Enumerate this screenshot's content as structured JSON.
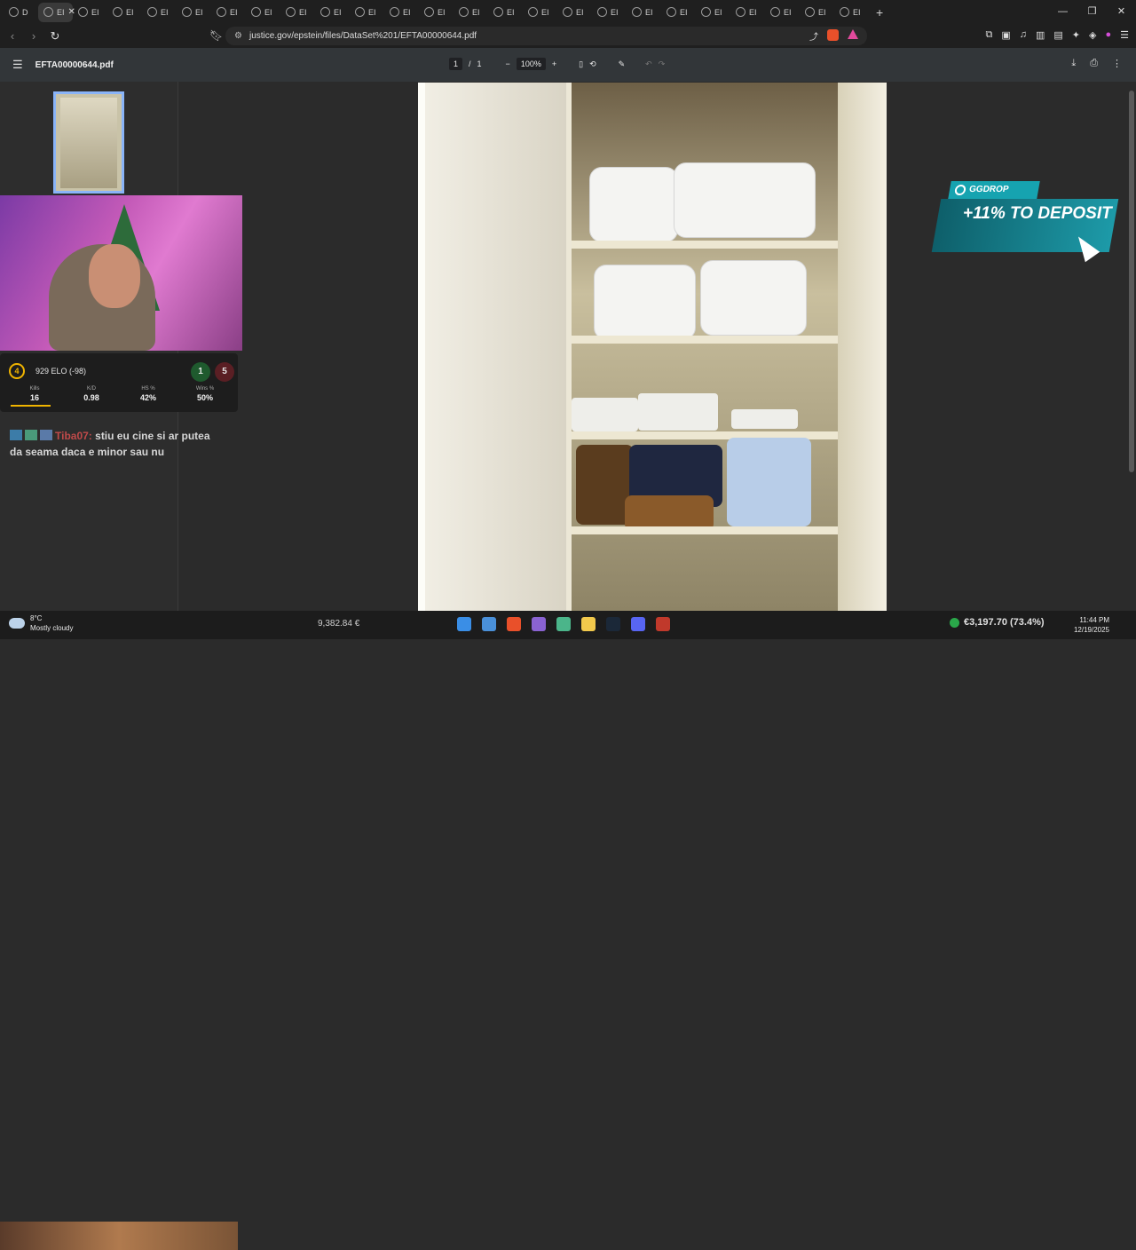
{
  "browser": {
    "tabs": [
      {
        "label": "D",
        "active": false
      },
      {
        "label": "EI",
        "active": true
      },
      {
        "label": "EI"
      },
      {
        "label": "EI"
      },
      {
        "label": "EI"
      },
      {
        "label": "EI"
      },
      {
        "label": "EI"
      },
      {
        "label": "EI"
      },
      {
        "label": "EI"
      },
      {
        "label": "EI"
      },
      {
        "label": "EI"
      },
      {
        "label": "EI"
      },
      {
        "label": "EI"
      },
      {
        "label": "EI"
      },
      {
        "label": "EI"
      },
      {
        "label": "EI"
      },
      {
        "label": "EI"
      },
      {
        "label": "EI"
      },
      {
        "label": "EI"
      },
      {
        "label": "EI"
      },
      {
        "label": "EI"
      },
      {
        "label": "EI"
      },
      {
        "label": "EI"
      },
      {
        "label": "EI"
      },
      {
        "label": "EI"
      }
    ],
    "url": "justice.gov/epstein/files/DataSet%201/EFTA00000644.pdf"
  },
  "pdf": {
    "filename": "EFTA00000644.pdf",
    "page_current": "1",
    "page_sep": "/",
    "page_total": "1",
    "zoom": "100%"
  },
  "stream": {
    "level": "4",
    "elo_text": "929 ELO (-98)",
    "wins": "1",
    "losses": "5",
    "stats": [
      {
        "label": "Kills",
        "value": "16"
      },
      {
        "label": "K/D",
        "value": "0.98"
      },
      {
        "label": "HS %",
        "value": "42%"
      },
      {
        "label": "Wins %",
        "value": "50%"
      }
    ],
    "chat_user": "Tiba07:",
    "chat_message": "stiu eu cine si ar putea da seama daca e minor sau nu"
  },
  "ad": {
    "brand": "GGDROP",
    "promo": "+11% TO DEPOSIT"
  },
  "taskbar": {
    "temp": "8°C",
    "condition": "Mostly cloudy",
    "balance": "9,382.84 €",
    "money": "€3,197.70 (73.4%)",
    "time": "11:44 PM",
    "date": "12/19/2025"
  }
}
